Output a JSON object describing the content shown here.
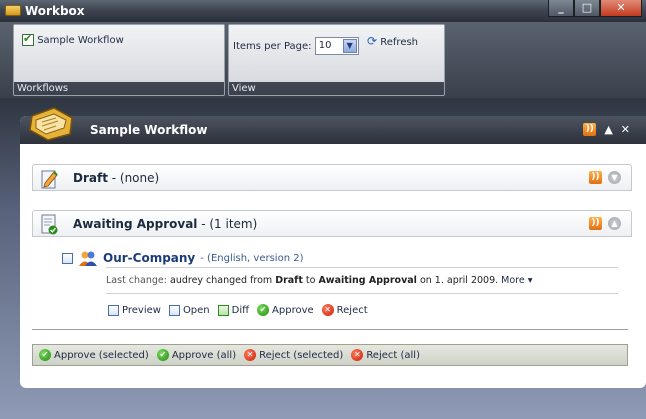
{
  "window": {
    "title": "Workbox"
  },
  "ribbon": {
    "workflows_group": {
      "label": "Workflows",
      "checkbox_label": "Sample Workflow",
      "checked": true
    },
    "view_group": {
      "label": "View",
      "items_per_page_label": "Items per Page:",
      "items_per_page_value": "10",
      "refresh_label": "Refresh"
    }
  },
  "panel": {
    "title": "Sample Workflow",
    "sections": [
      {
        "name": "Draft",
        "suffix": " - (none)"
      },
      {
        "name": "Awaiting Approval",
        "suffix": " - (1 item)"
      }
    ],
    "item": {
      "name": "Our-Company",
      "detail": " - (English, version 2)",
      "last_change_label": "Last change:",
      "last_change_text": " audrey changed from ",
      "from_state": "Draft",
      "to_word": " to ",
      "to_state": "Awaiting Approval",
      "date_text": " on 1. april 2009. ",
      "more_label": "More ▾",
      "actions": {
        "preview": "Preview",
        "open": "Open",
        "diff": "Diff",
        "approve": "Approve",
        "reject": "Reject"
      }
    },
    "bulk_actions": {
      "approve_selected": "Approve (selected)",
      "approve_all": "Approve (all)",
      "reject_selected": "Reject (selected)",
      "reject_all": "Reject (all)"
    }
  },
  "colors": {
    "accent": "#1a3d7a",
    "approve": "#1e8a12",
    "reject": "#c81e08",
    "rss": "#e07012"
  }
}
